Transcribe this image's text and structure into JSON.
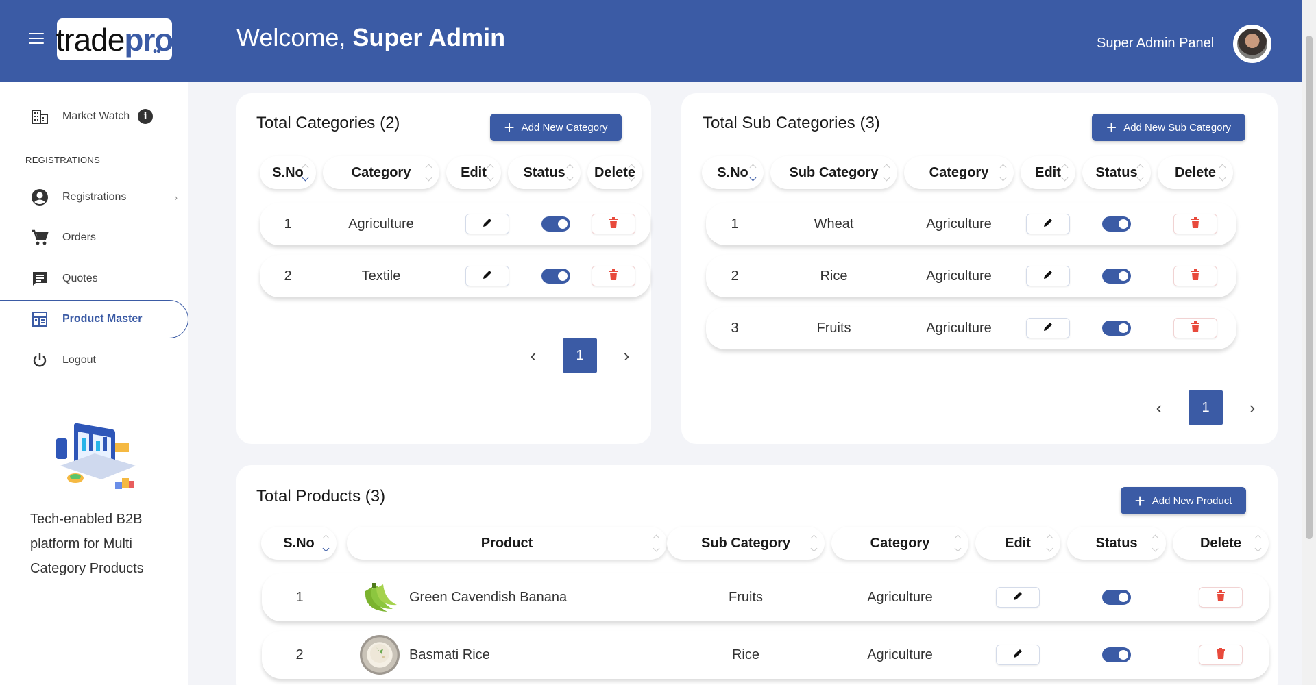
{
  "header": {
    "logo_part1": "trade",
    "logo_part2": "pro",
    "welcome_prefix": "Welcome,",
    "welcome_name": "Super Admin",
    "panel_label": "Super Admin Panel",
    "bg_color": "#3b5ba5"
  },
  "sidebar": {
    "market_watch": "Market Watch",
    "section_label": "REGISTRATIONS",
    "items": [
      {
        "label": "Registrations",
        "icon": "account-circle-icon"
      },
      {
        "label": "Orders",
        "icon": "cart-icon"
      },
      {
        "label": "Quotes",
        "icon": "chat-icon"
      },
      {
        "label": "Product Master",
        "icon": "product-master-icon",
        "active": true
      },
      {
        "label": "Logout",
        "icon": "power-icon"
      }
    ],
    "tagline": "Tech-enabled B2B platform for Multi Category Products"
  },
  "categories": {
    "title": "Total Categories (2)",
    "add_label": "Add New Category",
    "columns": [
      "S.No",
      "Category",
      "Edit",
      "Status",
      "Delete"
    ],
    "rows": [
      {
        "sno": "1",
        "category": "Agriculture",
        "status": "on"
      },
      {
        "sno": "2",
        "category": "Textile",
        "status": "on"
      }
    ],
    "page": "1"
  },
  "subcategories": {
    "title": "Total Sub Categories (3)",
    "add_label": "Add New Sub Category",
    "columns": [
      "S.No",
      "Sub Category",
      "Category",
      "Edit",
      "Status",
      "Delete"
    ],
    "rows": [
      {
        "sno": "1",
        "subcategory": "Wheat",
        "category": "Agriculture",
        "status": "on"
      },
      {
        "sno": "2",
        "subcategory": "Rice",
        "category": "Agriculture",
        "status": "on"
      },
      {
        "sno": "3",
        "subcategory": "Fruits",
        "category": "Agriculture",
        "status": "on"
      }
    ],
    "page": "1"
  },
  "products": {
    "title": "Total Products (3)",
    "add_label": "Add New Product",
    "columns": [
      "S.No",
      "Product",
      "Sub Category",
      "Category",
      "Edit",
      "Status",
      "Delete"
    ],
    "rows": [
      {
        "sno": "1",
        "product": "Green Cavendish Banana",
        "subcategory": "Fruits",
        "category": "Agriculture",
        "status": "on"
      },
      {
        "sno": "2",
        "product": "Basmati Rice",
        "subcategory": "Rice",
        "category": "Agriculture",
        "status": "on"
      }
    ]
  }
}
